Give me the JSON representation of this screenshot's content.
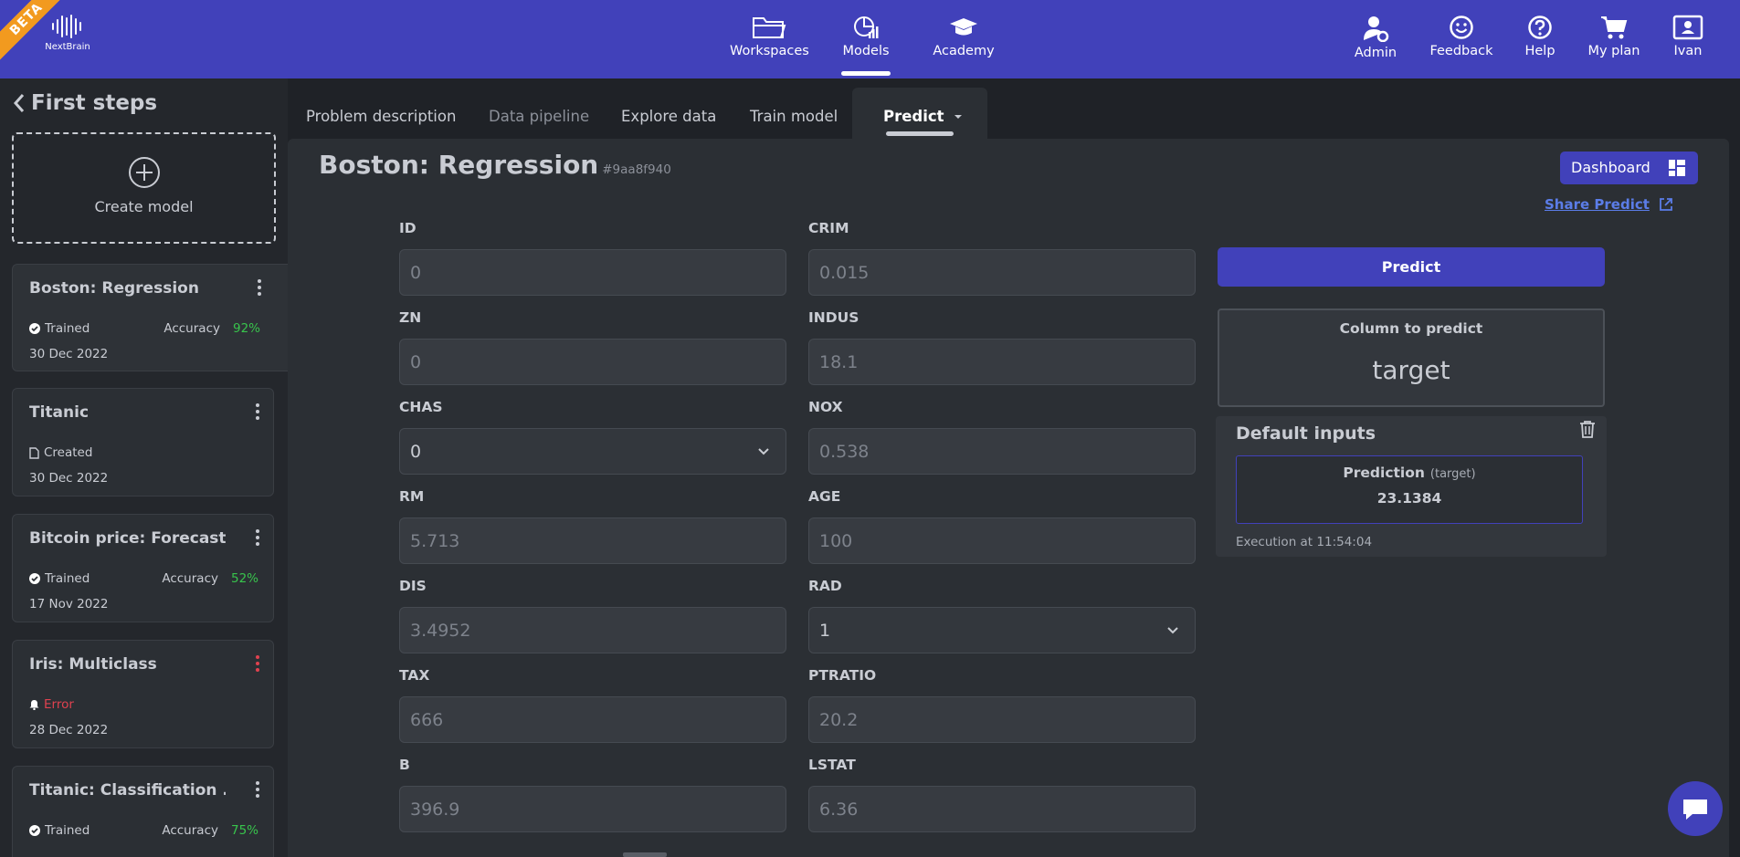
{
  "brand": {
    "beta": "BETA",
    "name": "NextBrain"
  },
  "nav": {
    "center": [
      {
        "label": "Workspaces",
        "icon": "folder-icon"
      },
      {
        "label": "Models",
        "icon": "chart-icon"
      },
      {
        "label": "Academy",
        "icon": "graduation-cap-icon"
      }
    ],
    "right": [
      {
        "label": "Admin",
        "icon": "user-gear-icon"
      },
      {
        "label": "Feedback",
        "icon": "smile-icon"
      },
      {
        "label": "Help",
        "icon": "question-icon"
      },
      {
        "label": "My plan",
        "icon": "cart-icon"
      },
      {
        "label": "Ivan",
        "icon": "user-card-icon"
      }
    ]
  },
  "sidebar": {
    "back_label": "First steps",
    "create_label": "Create model",
    "models": [
      {
        "name": "Boston: Regression",
        "status": "Trained",
        "accuracy_label": "Accuracy",
        "accuracy": "92%",
        "date": "30 Dec 2022"
      },
      {
        "name": "Titanic",
        "status": "Created",
        "accuracy_label": "",
        "accuracy": "",
        "date": "30 Dec 2022"
      },
      {
        "name": "Bitcoin price: Forecast",
        "status": "Trained",
        "accuracy_label": "Accuracy",
        "accuracy": "52%",
        "date": "17 Nov 2022"
      },
      {
        "name": "Iris: Multiclass",
        "status": "Error",
        "accuracy_label": "",
        "accuracy": "",
        "date": "28 Dec 2022"
      },
      {
        "name": "Titanic: Classification ...",
        "status": "Trained",
        "accuracy_label": "Accuracy",
        "accuracy": "75%",
        "date": ""
      }
    ]
  },
  "tabs": [
    "Problem description",
    "Data pipeline",
    "Explore data",
    "Train model",
    "Predict"
  ],
  "main": {
    "title": "Boston: Regression",
    "model_id": "#9aa8f940",
    "dashboard_label": "Dashboard",
    "share_label": "Share Predict",
    "fields": [
      {
        "label": "ID",
        "value": "0"
      },
      {
        "label": "CRIM",
        "value": "0.015"
      },
      {
        "label": "ZN",
        "value": "0"
      },
      {
        "label": "INDUS",
        "value": "18.1"
      },
      {
        "label": "CHAS",
        "value": "0"
      },
      {
        "label": "NOX",
        "value": "0.538"
      },
      {
        "label": "RM",
        "value": "5.713"
      },
      {
        "label": "AGE",
        "value": "100"
      },
      {
        "label": "DIS",
        "value": "3.4952"
      },
      {
        "label": "RAD",
        "value": "1"
      },
      {
        "label": "TAX",
        "value": "666"
      },
      {
        "label": "PTRATIO",
        "value": "20.2"
      },
      {
        "label": "B",
        "value": "396.9"
      },
      {
        "label": "LSTAT",
        "value": "6.36"
      }
    ],
    "predict_label": "Predict",
    "column_to_predict_label": "Column to predict",
    "column_to_predict": "target",
    "default_inputs_label": "Default inputs",
    "prediction_label": "Prediction",
    "prediction_target": "(target)",
    "prediction_value": "23.1384",
    "execution": "Execution at 11:54:04"
  },
  "colors": {
    "header": "#4141ba",
    "background": "#1f2227",
    "panel": "#2b2f34",
    "accent": "#4141ba",
    "success": "#38c44c",
    "error": "#e0424f",
    "link": "#5b7de8"
  }
}
